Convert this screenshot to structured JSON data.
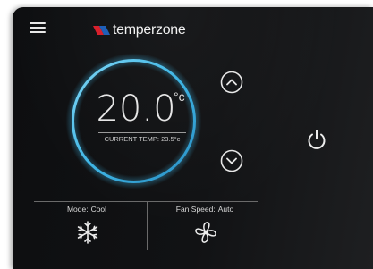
{
  "brand": {
    "name": "temperzone",
    "logo_colors": [
      "#d8202c",
      "#1f5fb8"
    ]
  },
  "header": {
    "menu_icon": "hamburger-menu-icon"
  },
  "thermostat": {
    "setpoint": "20.0",
    "unit": "°c",
    "current_label": "CURRENT TEMP:",
    "current_value": "23.5°c",
    "ring_color": "#3fb6e6",
    "increase_icon": "chevron-up-icon",
    "decrease_icon": "chevron-down-icon"
  },
  "controls": {
    "mode": {
      "label": "Mode:",
      "value": "Cool",
      "icon": "snowflake-icon"
    },
    "fan": {
      "label": "Fan Speed:",
      "value": "Auto",
      "icon": "fan-icon"
    }
  },
  "power": {
    "icon": "power-icon"
  }
}
